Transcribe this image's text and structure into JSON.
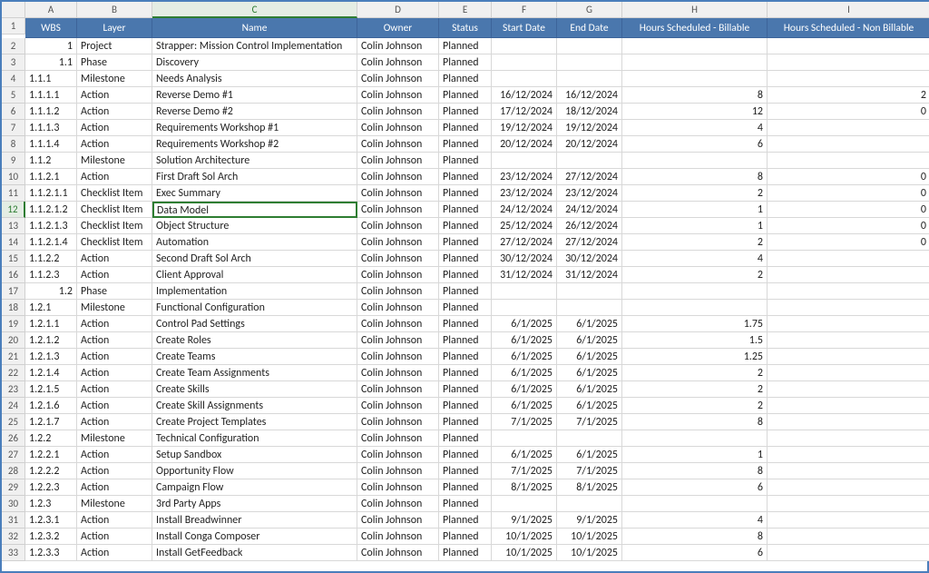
{
  "columns": [
    "A",
    "B",
    "C",
    "D",
    "E",
    "F",
    "G",
    "H",
    "I"
  ],
  "selected": {
    "row": 12,
    "col": "C"
  },
  "headers": {
    "A": "WBS",
    "B": "Layer",
    "C": "Name",
    "D": "Owner",
    "E": "Status",
    "F": "Start Date",
    "G": "End Date",
    "H": "Hours Scheduled - Billable",
    "I": "Hours Scheduled - Non Billable"
  },
  "rows": [
    {
      "r": 2,
      "A": "1",
      "B": "Project",
      "C": "Strapper: Mission Control Implementation",
      "D": "Colin Johnson",
      "E": "Planned",
      "F": "",
      "G": "",
      "H": "",
      "I": ""
    },
    {
      "r": 3,
      "A": "1.1",
      "B": "Phase",
      "C": "Discovery",
      "D": "Colin Johnson",
      "E": "Planned",
      "F": "",
      "G": "",
      "H": "",
      "I": ""
    },
    {
      "r": 4,
      "A": "1.1.1",
      "B": "Milestone",
      "C": "Needs Analysis",
      "D": "Colin Johnson",
      "E": "Planned",
      "F": "",
      "G": "",
      "H": "",
      "I": ""
    },
    {
      "r": 5,
      "A": "1.1.1.1",
      "B": "Action",
      "C": "Reverse Demo #1",
      "D": "Colin Johnson",
      "E": "Planned",
      "F": "16/12/2024",
      "G": "16/12/2024",
      "H": "8",
      "I": "2"
    },
    {
      "r": 6,
      "A": "1.1.1.2",
      "B": "Action",
      "C": "Reverse Demo #2",
      "D": "Colin Johnson",
      "E": "Planned",
      "F": "17/12/2024",
      "G": "18/12/2024",
      "H": "12",
      "I": "0"
    },
    {
      "r": 7,
      "A": "1.1.1.3",
      "B": "Action",
      "C": "Requirements Workshop #1",
      "D": "Colin Johnson",
      "E": "Planned",
      "F": "19/12/2024",
      "G": "19/12/2024",
      "H": "4",
      "I": ""
    },
    {
      "r": 8,
      "A": "1.1.1.4",
      "B": "Action",
      "C": "Requirements Workshop #2",
      "D": "Colin Johnson",
      "E": "Planned",
      "F": "20/12/2024",
      "G": "20/12/2024",
      "H": "6",
      "I": ""
    },
    {
      "r": 9,
      "A": "1.1.2",
      "B": "Milestone",
      "C": "Solution Architecture",
      "D": "Colin Johnson",
      "E": "Planned",
      "F": "",
      "G": "",
      "H": "",
      "I": ""
    },
    {
      "r": 10,
      "A": "1.1.2.1",
      "B": "Action",
      "C": "First Draft Sol Arch",
      "D": "Colin Johnson",
      "E": "Planned",
      "F": "23/12/2024",
      "G": "27/12/2024",
      "H": "8",
      "I": "0"
    },
    {
      "r": 11,
      "A": "1.1.2.1.1",
      "B": "Checklist Item",
      "C": "Exec Summary",
      "D": "Colin Johnson",
      "E": "Planned",
      "F": "23/12/2024",
      "G": "23/12/2024",
      "H": "2",
      "I": "0"
    },
    {
      "r": 12,
      "A": "1.1.2.1.2",
      "B": "Checklist Item",
      "C": "Data Model",
      "D": "Colin Johnson",
      "E": "Planned",
      "F": "24/12/2024",
      "G": "24/12/2024",
      "H": "1",
      "I": "0"
    },
    {
      "r": 13,
      "A": "1.1.2.1.3",
      "B": "Checklist Item",
      "C": "Object Structure",
      "D": "Colin Johnson",
      "E": "Planned",
      "F": "25/12/2024",
      "G": "26/12/2024",
      "H": "1",
      "I": "0"
    },
    {
      "r": 14,
      "A": "1.1.2.1.4",
      "B": "Checklist Item",
      "C": "Automation",
      "D": "Colin Johnson",
      "E": "Planned",
      "F": "27/12/2024",
      "G": "27/12/2024",
      "H": "2",
      "I": "0"
    },
    {
      "r": 15,
      "A": "1.1.2.2",
      "B": "Action",
      "C": "Second Draft Sol Arch",
      "D": "Colin Johnson",
      "E": "Planned",
      "F": "30/12/2024",
      "G": "30/12/2024",
      "H": "4",
      "I": ""
    },
    {
      "r": 16,
      "A": "1.1.2.3",
      "B": "Action",
      "C": "Client Approval",
      "D": "Colin Johnson",
      "E": "Planned",
      "F": "31/12/2024",
      "G": "31/12/2024",
      "H": "2",
      "I": ""
    },
    {
      "r": 17,
      "A": "1.2",
      "B": "Phase",
      "C": "Implementation",
      "D": "Colin Johnson",
      "E": "Planned",
      "F": "",
      "G": "",
      "H": "",
      "I": ""
    },
    {
      "r": 18,
      "A": "1.2.1",
      "B": "Milestone",
      "C": "Functional Configuration",
      "D": "Colin Johnson",
      "E": "Planned",
      "F": "",
      "G": "",
      "H": "",
      "I": ""
    },
    {
      "r": 19,
      "A": "1.2.1.1",
      "B": "Action",
      "C": "Control Pad Settings",
      "D": "Colin Johnson",
      "E": "Planned",
      "F": "6/1/2025",
      "G": "6/1/2025",
      "H": "1.75",
      "I": ""
    },
    {
      "r": 20,
      "A": "1.2.1.2",
      "B": "Action",
      "C": "Create Roles",
      "D": "Colin Johnson",
      "E": "Planned",
      "F": "6/1/2025",
      "G": "6/1/2025",
      "H": "1.5",
      "I": ""
    },
    {
      "r": 21,
      "A": "1.2.1.3",
      "B": "Action",
      "C": "Create Teams",
      "D": "Colin Johnson",
      "E": "Planned",
      "F": "6/1/2025",
      "G": "6/1/2025",
      "H": "1.25",
      "I": ""
    },
    {
      "r": 22,
      "A": "1.2.1.4",
      "B": "Action",
      "C": "Create Team Assignments",
      "D": "Colin Johnson",
      "E": "Planned",
      "F": "6/1/2025",
      "G": "6/1/2025",
      "H": "2",
      "I": ""
    },
    {
      "r": 23,
      "A": "1.2.1.5",
      "B": "Action",
      "C": "Create Skills",
      "D": "Colin Johnson",
      "E": "Planned",
      "F": "6/1/2025",
      "G": "6/1/2025",
      "H": "2",
      "I": ""
    },
    {
      "r": 24,
      "A": "1.2.1.6",
      "B": "Action",
      "C": "Create Skill Assignments",
      "D": "Colin Johnson",
      "E": "Planned",
      "F": "6/1/2025",
      "G": "6/1/2025",
      "H": "2",
      "I": ""
    },
    {
      "r": 25,
      "A": "1.2.1.7",
      "B": "Action",
      "C": "Create Project Templates",
      "D": "Colin Johnson",
      "E": "Planned",
      "F": "7/1/2025",
      "G": "7/1/2025",
      "H": "8",
      "I": ""
    },
    {
      "r": 26,
      "A": "1.2.2",
      "B": "Milestone",
      "C": "Technical Configuration",
      "D": "Colin Johnson",
      "E": "Planned",
      "F": "",
      "G": "",
      "H": "",
      "I": ""
    },
    {
      "r": 27,
      "A": "1.2.2.1",
      "B": "Action",
      "C": "Setup Sandbox",
      "D": "Colin Johnson",
      "E": "Planned",
      "F": "6/1/2025",
      "G": "6/1/2025",
      "H": "1",
      "I": ""
    },
    {
      "r": 28,
      "A": "1.2.2.2",
      "B": "Action",
      "C": "Opportunity Flow",
      "D": "Colin Johnson",
      "E": "Planned",
      "F": "7/1/2025",
      "G": "7/1/2025",
      "H": "8",
      "I": ""
    },
    {
      "r": 29,
      "A": "1.2.2.3",
      "B": "Action",
      "C": "Campaign Flow",
      "D": "Colin Johnson",
      "E": "Planned",
      "F": "8/1/2025",
      "G": "8/1/2025",
      "H": "6",
      "I": ""
    },
    {
      "r": 30,
      "A": "1.2.3",
      "B": "Milestone",
      "C": "3rd Party Apps",
      "D": "Colin Johnson",
      "E": "Planned",
      "F": "",
      "G": "",
      "H": "",
      "I": ""
    },
    {
      "r": 31,
      "A": "1.2.3.1",
      "B": "Action",
      "C": "Install Breadwinner",
      "D": "Colin Johnson",
      "E": "Planned",
      "F": "9/1/2025",
      "G": "9/1/2025",
      "H": "4",
      "I": ""
    },
    {
      "r": 32,
      "A": "1.2.3.2",
      "B": "Action",
      "C": "Install Conga Composer",
      "D": "Colin Johnson",
      "E": "Planned",
      "F": "10/1/2025",
      "G": "10/1/2025",
      "H": "8",
      "I": ""
    },
    {
      "r": 33,
      "A": "1.2.3.3",
      "B": "Action",
      "C": "Install GetFeedback",
      "D": "Colin Johnson",
      "E": "Planned",
      "F": "10/1/2025",
      "G": "10/1/2025",
      "H": "6",
      "I": ""
    }
  ],
  "numeric_cols_right_align": {
    "A": [
      "2",
      "3",
      "17"
    ],
    "F": true,
    "G": true,
    "H": true,
    "I": true
  }
}
